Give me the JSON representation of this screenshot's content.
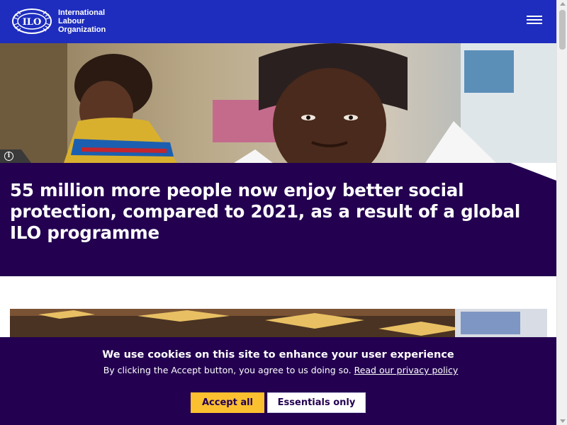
{
  "header": {
    "logo_text": "International Labour Organization",
    "logo_lines": [
      "International",
      "Labour",
      "Organization"
    ],
    "emblem_text": "ILO",
    "menu_icon": "hamburger-icon",
    "brand_color": "#1e2dbe"
  },
  "hero": {
    "info_icon": "info-icon",
    "info_glyph": "i"
  },
  "headline": {
    "text": "55 million more people now enjoy better social protection, compared to 2021, as a result of a global ILO programme",
    "band_color": "#230050"
  },
  "cookie_banner": {
    "title": "We use cookies on this site to enhance your user experience",
    "text": "By clicking the Accept button, you agree to us doing so.",
    "link_text": "Read our privacy policy",
    "accept_label": "Accept all",
    "essentials_label": "Essentials only",
    "accept_color": "#fbc030"
  }
}
